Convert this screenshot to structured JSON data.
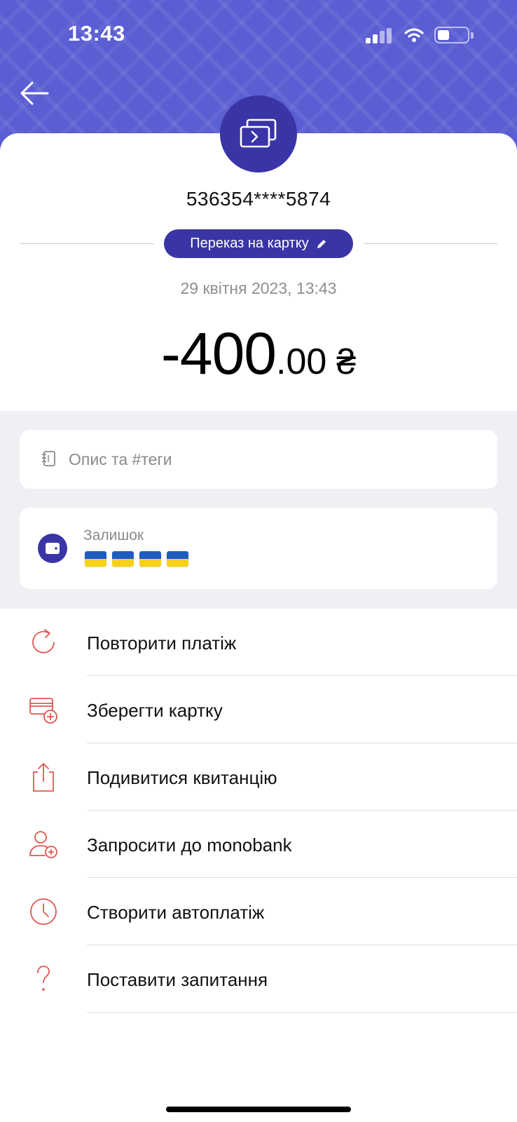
{
  "status_bar": {
    "time": "13:43"
  },
  "transaction": {
    "card_number": "536354****5874",
    "category": "Переказ на картку",
    "date": "29 квітня 2023, 13:43",
    "amount_integer": "-400",
    "amount_decimal": ".00",
    "currency": "₴"
  },
  "description": {
    "placeholder": "Опис та #теги"
  },
  "balance": {
    "label": "Залишок",
    "flags": [
      "🇺🇦",
      "🇺🇦",
      "🇺🇦",
      "🇺🇦"
    ]
  },
  "actions": [
    {
      "label": "Повторити платіж",
      "icon": "repeat-icon"
    },
    {
      "label": "Зберегти картку",
      "icon": "save-card-icon"
    },
    {
      "label": "Подивитися квитанцію",
      "icon": "share-icon"
    },
    {
      "label": "Запросити до monobank",
      "icon": "add-user-icon"
    },
    {
      "label": "Створити автоплатіж",
      "icon": "clock-icon"
    },
    {
      "label": "Поставити запитання",
      "icon": "question-icon"
    }
  ],
  "colors": {
    "header": "#5b5ed2",
    "accent": "#3a35a6",
    "action_icon": "#e0574f",
    "gray_background": "#efeff4"
  }
}
